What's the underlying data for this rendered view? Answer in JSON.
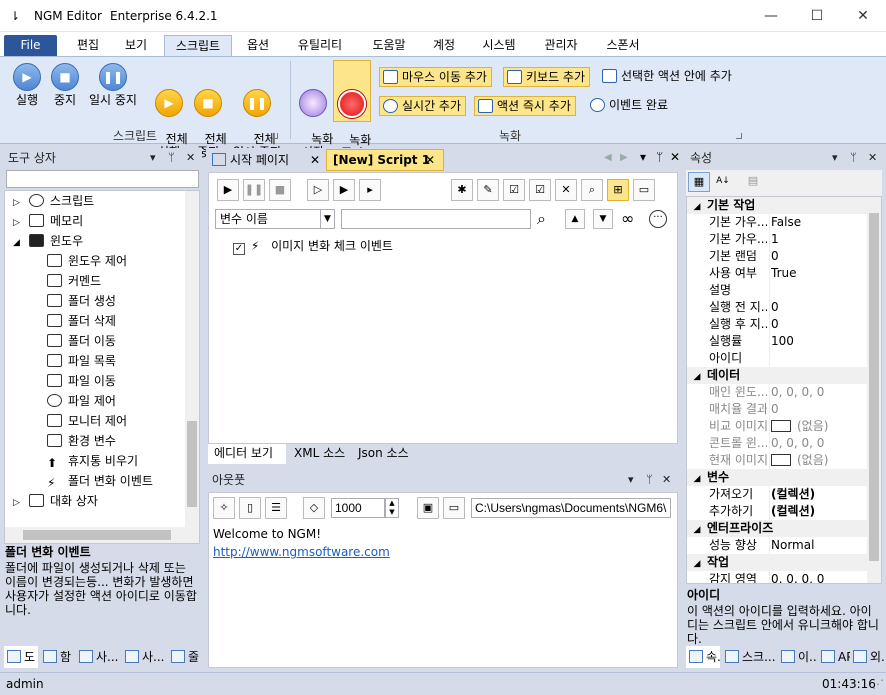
{
  "window": {
    "app": "NGM Editor",
    "edition": "Enterprise 6.4.2.1",
    "menu_glyph": "⇂",
    "min": "—",
    "max": "☐",
    "close": "✕"
  },
  "menu_tabs": [
    "File",
    "편집",
    "보기",
    "스크립트",
    "옵션",
    "유틸리티",
    "도움말",
    "계정",
    "시스템",
    "관리자",
    "스폰서"
  ],
  "ribbon": {
    "buttons": [
      "실행",
      "중지",
      "일시 중지",
      "전체\n실행",
      "전체\n중지",
      "전체\n일시 중지",
      "녹화\n시작",
      "녹화\n중지"
    ],
    "glyphs": {
      "play": "▶",
      "stop": "■",
      "pause": "❚❚"
    },
    "group_script": "스크립트",
    "group_record": "녹화",
    "small": [
      "마우스 이동 추가",
      "키보드 추가",
      "선택한 액션 안에 추가",
      "실시간 추가",
      "액션 즉시 추가",
      "이벤트 완료"
    ]
  },
  "toolbox": {
    "title": "도구 상자",
    "search_value": "",
    "items": [
      {
        "label": "스크립트",
        "toggle": "▷"
      },
      {
        "label": "메모리",
        "toggle": "▷"
      },
      {
        "label": "윈도우",
        "toggle": "◢"
      },
      {
        "label": "윈도우 제어"
      },
      {
        "label": "커멘드"
      },
      {
        "label": "폴더 생성"
      },
      {
        "label": "폴더 삭제"
      },
      {
        "label": "폴더 이동"
      },
      {
        "label": "파일 목록"
      },
      {
        "label": "파일 이동"
      },
      {
        "label": "파일 제어"
      },
      {
        "label": "모니터 제어"
      },
      {
        "label": "환경 변수"
      },
      {
        "label": "휴지통 비우기"
      },
      {
        "label": "폴더 변화 이벤트"
      },
      {
        "label": "대화 상자",
        "toggle": "▷"
      }
    ],
    "desc_title": "폴더 변화 이벤트",
    "desc_text": "폴더에 파일이 생성되거나 삭제 또는 이름이 변경되는등... 변화가 발생하면 사용자가 설정한 액션 아이디로 이동합니다.",
    "bottom_tabs": [
      "도",
      "함",
      "사...",
      "사...",
      "줄"
    ]
  },
  "doc_tabs": [
    "시작 페이지",
    "[New] Script 1"
  ],
  "editor": {
    "var_select": "변수 이름",
    "search_value": "",
    "event_item": "이미지 변화 체크 이벤트",
    "view_tabs": [
      "에디터 보기",
      "XML 소스",
      "Json 소스"
    ]
  },
  "output": {
    "title": "아웃풋",
    "count": "1000",
    "path": "C:\\Users\\ngmas\\Documents\\NGM6\\",
    "line1": "Welcome to NGM!",
    "line2": "http://www.ngmsoftware.com"
  },
  "properties": {
    "title": "속성",
    "rows": [
      {
        "cat": "기본 작업"
      },
      {
        "k": "기본 가우...",
        "v": "False"
      },
      {
        "k": "기본 가우...",
        "v": "1"
      },
      {
        "k": "기본 랜덤",
        "v": "0"
      },
      {
        "k": "사용 여부",
        "v": "True"
      },
      {
        "k": "설명",
        "v": ""
      },
      {
        "k": "실행 전 지...",
        "v": "0"
      },
      {
        "k": "실행 후 지...",
        "v": "0"
      },
      {
        "k": "실행률",
        "v": "100"
      },
      {
        "k": "아이디",
        "v": ""
      },
      {
        "cat": "데이터"
      },
      {
        "k": "매인 윈도...",
        "v": "0, 0, 0, 0",
        "gray": true
      },
      {
        "k": "매치율 결과",
        "v": "0",
        "gray": true
      },
      {
        "k": "비교 이미지",
        "v": "(없음)",
        "gray": true,
        "box": true
      },
      {
        "k": "콘트롤 윈...",
        "v": "0, 0, 0, 0",
        "gray": true
      },
      {
        "k": "현재 이미지",
        "v": "(없음)",
        "gray": true,
        "box": true
      },
      {
        "cat": "변수"
      },
      {
        "k": "가져오기",
        "v": "(컬렉션)",
        "bold": true
      },
      {
        "k": "추가하기",
        "v": "(컬렉션)",
        "bold": true
      },
      {
        "cat": "엔터프라이즈"
      },
      {
        "k": "성능 향상",
        "v": "Normal"
      },
      {
        "cat": "작업"
      },
      {
        "k": "감지 영역",
        "v": "0, 0, 0, 0"
      }
    ],
    "desc_title": "아이디",
    "desc_text": "이 액션의 아이디를 입력하세요. 아이디는 스크립트 안에서 유니크해야 합니다.",
    "bottom_tabs": [
      "속...",
      "스크...",
      "이...",
      "API",
      "외..."
    ]
  },
  "status": {
    "user": "admin",
    "time": "01:43:16"
  }
}
